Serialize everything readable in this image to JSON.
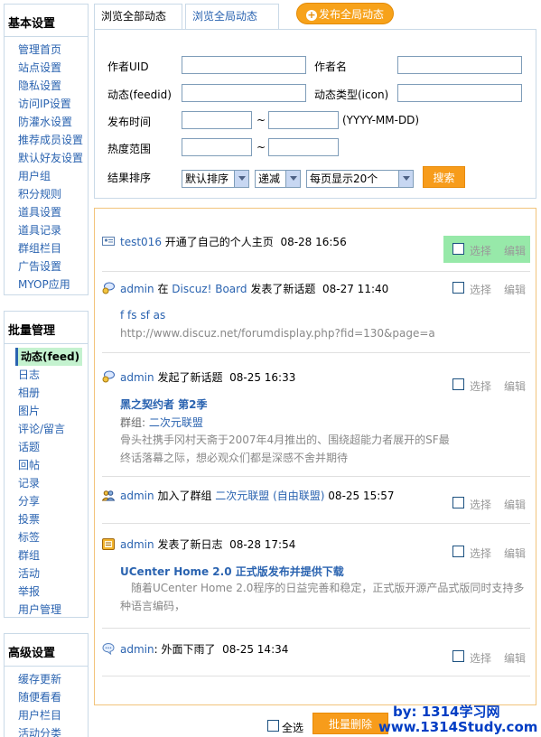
{
  "sidebar": {
    "basic": {
      "title": "基本设置",
      "items": [
        "管理首页",
        "站点设置",
        "隐私设置",
        "访问IP设置",
        "防灌水设置",
        "推荐成员设置",
        "默认好友设置",
        "用户组",
        "积分规则",
        "道具设置",
        "道具记录",
        "群组栏目",
        "广告设置",
        "MYOP应用"
      ]
    },
    "batch": {
      "title": "批量管理",
      "active": "动态(feed)",
      "items": [
        "日志",
        "相册",
        "图片",
        "评论/留言",
        "话题",
        "回帖",
        "记录",
        "分享",
        "投票",
        "标签",
        "群组",
        "活动",
        "举报",
        "用户管理"
      ]
    },
    "advanced": {
      "title": "高级设置",
      "items": [
        "缓存更新",
        "随便看看",
        "用户栏目",
        "活动分类"
      ]
    }
  },
  "tabs": {
    "all_feeds": "浏览全部动态",
    "global_feeds": "浏览全局动态",
    "publish": "发布全局动态"
  },
  "search": {
    "author_uid_label": "作者UID",
    "author_uid_value": "",
    "author_name_label": "作者名",
    "author_name_value": "",
    "feedid_label": "动态(feedid)",
    "feedid_value": "",
    "icon_label": "动态类型(icon)",
    "icon_value": "",
    "time_label": "发布时间",
    "time_from": "",
    "time_to": "",
    "time_sep": "~",
    "time_hint": "(YYYY-MM-DD)",
    "hot_label": "热度范围",
    "hot_from": "",
    "hot_to": "",
    "hot_sep": "~",
    "order_label": "结果排序",
    "order_by": "默认排序",
    "order_dir": "递减",
    "per_page": "每页显示20个",
    "search_button": "搜索"
  },
  "feeds": [
    {
      "user": "test016",
      "text": "开通了自己的个人主页",
      "time": "08-28 16:56"
    },
    {
      "user": "admin",
      "pre": "在",
      "board": "Discuz! Board",
      "text": "发表了新话题",
      "time": "08-27 11:40",
      "title": "f fs sf as",
      "link": "http://www.discuz.net/forumdisplay.php?fid=130&page=a"
    },
    {
      "user": "admin",
      "text": "发起了新话题",
      "time": "08-25 16:33",
      "title": "黑之契约者  第2季",
      "group_label": "群组:",
      "group": "二次元联盟",
      "body": "骨头社携手冈村天斋于2007年4月推出的、围绕超能力者展开的SF最终话落幕之际，想必观众们都是深感不舍并期待"
    },
    {
      "user": "admin",
      "text": "加入了群组",
      "group": "二次元联盟 (自由联盟)",
      "time": "08-25 15:57"
    },
    {
      "user": "admin",
      "text": "发表了新日志",
      "time": "08-28 17:54",
      "title": "UCenter Home 2.0 正式版发布并提供下载",
      "body": "随着UCenter Home 2.0程序的日益完善和稳定，正式版开源产品式版同时支持多种语言编码，"
    },
    {
      "user": "admin",
      "text": ": 外面下雨了",
      "time": "08-25 14:34"
    }
  ],
  "ops": {
    "select": "选择",
    "edit": "编辑"
  },
  "bottom": {
    "select_all": "全选",
    "batch_delete": "批量删除"
  },
  "watermark": {
    "line1": "by: 1314学习网",
    "line2": "www.1314Study.com"
  }
}
